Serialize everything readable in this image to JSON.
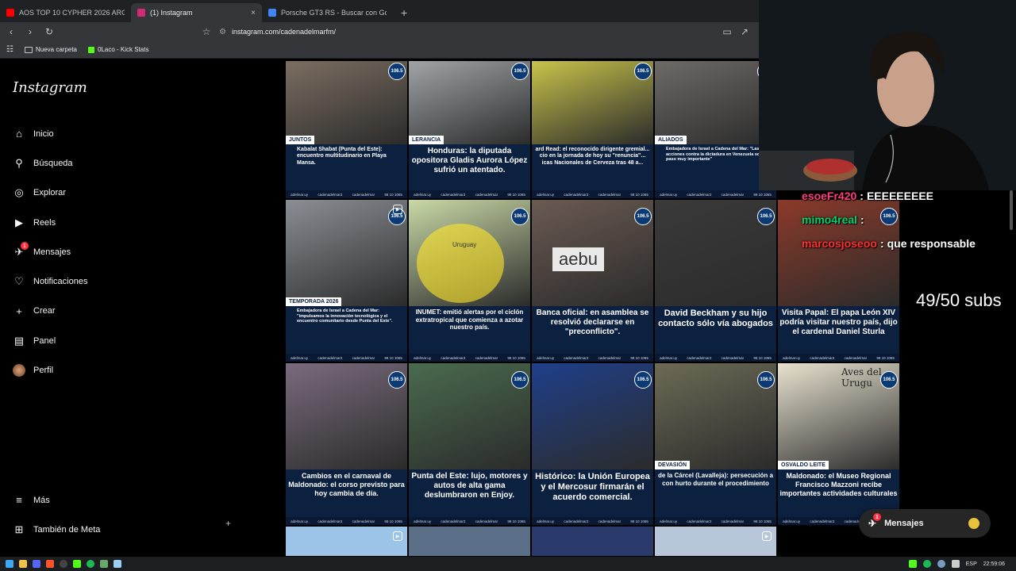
{
  "browser": {
    "tabs": [
      {
        "title": "AOS TOP 10 CYPHER 2026 ARG - You",
        "favicon_color": "#ff0000",
        "active": false
      },
      {
        "title": "(1) Instagram",
        "favicon_color": "#d62976",
        "active": true
      },
      {
        "title": "Porsche GT3 RS - Buscar con Google",
        "favicon_color": "#4285f4",
        "active": false
      }
    ],
    "close_glyph": "×",
    "new_tab_glyph": "+",
    "url": "instagram.com/cadenadelmarfm/",
    "bookmarks": [
      {
        "label": "Nueva carpeta",
        "icon": "folder-icon"
      },
      {
        "label": "0Laco - Kick Stats",
        "icon": "kick-icon"
      }
    ]
  },
  "sidebar": {
    "logo": "Instagram",
    "items": [
      {
        "label": "Inicio",
        "icon": "home-icon",
        "glyph": "⌂"
      },
      {
        "label": "Búsqueda",
        "icon": "search-icon",
        "glyph": "⚲"
      },
      {
        "label": "Explorar",
        "icon": "compass-icon",
        "glyph": "◎"
      },
      {
        "label": "Reels",
        "icon": "reels-icon",
        "glyph": "▶"
      },
      {
        "label": "Mensajes",
        "icon": "messenger-icon",
        "glyph": "✈",
        "badge": "1"
      },
      {
        "label": "Notificaciones",
        "icon": "heart-icon",
        "glyph": "♡"
      },
      {
        "label": "Crear",
        "icon": "plus-icon",
        "glyph": "+"
      },
      {
        "label": "Panel",
        "icon": "dashboard-icon",
        "glyph": "▤"
      },
      {
        "label": "Perfil",
        "icon": "avatar-icon",
        "glyph": ""
      }
    ],
    "bottom": [
      {
        "label": "Más",
        "icon": "menu-icon",
        "glyph": "≡"
      },
      {
        "label": "También de Meta",
        "icon": "meta-icon",
        "glyph": "⊞"
      }
    ]
  },
  "posts": [
    {
      "caption": "Kabalat Shabat (Punta del Este): encuentro multitudinario en Playa Mansa.",
      "tag": "JUNTOS",
      "bg": "#7c6e61",
      "cap_size": 7,
      "left_align": true
    },
    {
      "caption": "Honduras: la diputada opositora Gladis Aurora López sufrió un atentado.",
      "tag": "LERANCIA",
      "bg": "#a0a4a8",
      "cap_size": 10
    },
    {
      "caption": "ard Read: el reconocido dirigente gremial... cio en la jornada de hoy su \"renuncia\"... icas Nacionales de Cerveza tras 48 a...",
      "tag": "",
      "bg": "#c8c34a",
      "cap_size": 7
    },
    {
      "caption": "Embajadora de Israel a Cadena del Mar: \"Las acciones contra la dictadura en Venezuela son un paso muy importante\"",
      "tag": "ALIADOS",
      "bg": "#6e6a68",
      "cap_size": 5.5,
      "left_align": true
    },
    {
      "caption": "",
      "tag": "",
      "bg": "#000000",
      "cap_size": 7,
      "empty": true
    },
    {
      "caption": "Embajadora de Israel a Cadena del Mar: \"impulsamos la innovación tecnológica y el encuentro comunitario desde Punta del Este\".",
      "tag": "TEMPORADA 2026",
      "bg": "#8a8f95",
      "cap_size": 5.5,
      "left_align": true,
      "video": true
    },
    {
      "caption": "INUMET: emitió alertas por el ciclón extratropical que comienza a azotar nuestro país.",
      "tag": "",
      "bg": "#c9d9a6",
      "cap_size": 8,
      "map": true,
      "map_label": "Uruguay"
    },
    {
      "caption": "Banca oficial: en asamblea se resolvió declararse en \"preconflicto\".",
      "tag": "",
      "bg": "#6b5a52",
      "cap_size": 10,
      "sign": "aebu"
    },
    {
      "caption": "David Beckham y su hijo contacto sólo vía abogados",
      "tag": "",
      "bg": "#3a3a3a",
      "cap_size": 11
    },
    {
      "caption": "Visita Papal: El papa León XIV podría visitar nuestro país, dijo el cardenal Daniel Sturla",
      "tag": "",
      "bg": "#8b3a2a",
      "cap_size": 10
    },
    {
      "caption": "Cambios en el carnaval de Maldonado: el corso previsto para hoy cambia de día.",
      "tag": "",
      "bg": "#7a6b7d",
      "cap_size": 9
    },
    {
      "caption": "Punta del Este: lujo, motores y autos de alta gama deslumbraron en Enjoy.",
      "tag": "",
      "bg": "#4a6b4e",
      "cap_size": 10
    },
    {
      "caption": "Histórico: la Unión Europea y el Mercosur firmarán el acuerdo comercial.",
      "tag": "",
      "bg": "#1f3f8a",
      "cap_size": 11
    },
    {
      "caption": "de la Cárcel (Lavalleja): persecución a con hurto durante el procedimiento",
      "tag": "DEVASIÓN",
      "bg": "#6d6a55",
      "cap_size": 8
    },
    {
      "caption": "Maldonado: el Museo Regional Francisco Mazzoni recibe importantes actividades culturales",
      "tag": "OSVALDO LEITE",
      "bg": "#e8e2cf",
      "cap_size": 9,
      "book": "Aves del Urugu"
    },
    {
      "caption": "",
      "tag": "",
      "bg": "#9cc4e8",
      "cap_size": 7,
      "strip": true,
      "video": true
    },
    {
      "caption": "",
      "tag": "",
      "bg": "#5b7088",
      "cap_size": 7,
      "strip": true
    },
    {
      "caption": "",
      "tag": "",
      "bg": "#2a3a6a",
      "cap_size": 7,
      "strip": true
    },
    {
      "caption": "",
      "tag": "",
      "bg": "#b7c6d8",
      "cap_size": 7,
      "strip": true,
      "video": true
    },
    {
      "caption": "",
      "tag": "",
      "bg": "#000000",
      "cap_size": 7,
      "strip": true
    }
  ],
  "post_footer": {
    "site": "adelmar.uy",
    "handle_ig": "cadenadelmar2",
    "handle_fb": "cadenadelmar",
    "phone": "98 10 1065",
    "station": "106.5"
  },
  "stream_overlay": {
    "chat": [
      {
        "user": "esoeFr420",
        "text": "EEEEEEEEE",
        "color": "#ff3b7a"
      },
      {
        "user": "mimo4real",
        "text": "",
        "color": "#00d26a"
      },
      {
        "user": "marcosjoseoo",
        "text": "que responsable",
        "color": "#ff3030"
      }
    ],
    "subs": "49/50 subs"
  },
  "messages_pill": {
    "label": "Mensajes",
    "badge": "1"
  },
  "taskbar": {
    "lang": "ESP",
    "time": "22:59:06"
  }
}
